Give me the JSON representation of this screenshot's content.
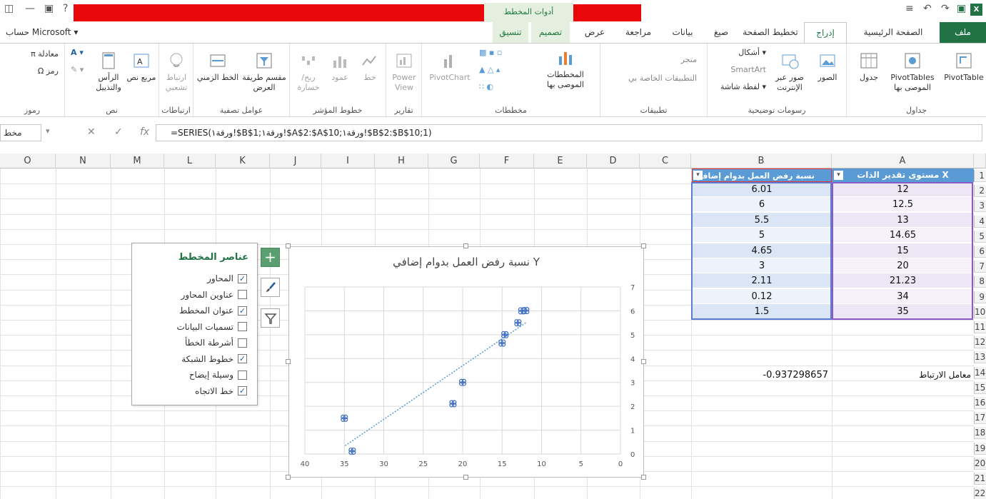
{
  "window": {
    "tools_context": "أدوات المخطط",
    "account": "حساب Microsoft ▾",
    "excel_logo": "X"
  },
  "tabs": [
    {
      "id": "file",
      "label": "ملف"
    },
    {
      "id": "home",
      "label": "الصفحة الرئيسية"
    },
    {
      "id": "insert",
      "label": "إدراج"
    },
    {
      "id": "page-layout",
      "label": "تخطيط الصفحة"
    },
    {
      "id": "formulas",
      "label": "صيغ"
    },
    {
      "id": "data",
      "label": "بيانات"
    },
    {
      "id": "review",
      "label": "مراجعة"
    },
    {
      "id": "view",
      "label": "عرض"
    },
    {
      "id": "design",
      "label": "تصميم"
    },
    {
      "id": "format",
      "label": "تنسيق"
    }
  ],
  "ribbon": {
    "tables": {
      "label": "جداول",
      "pivot_table": "PivotTable",
      "recommended_pivot": "PivotTables الموصى بها",
      "table": "جدول"
    },
    "illustrations": {
      "label": "رسومات توضيحية",
      "pictures": "الصور",
      "online_pictures": "صور عبر الإنترنت",
      "shapes": "أشكال ▾",
      "smartart": "SmartArt",
      "screenshot": "لقطة شاشة ▾"
    },
    "apps": {
      "label": "تطبيقات",
      "store": "متجر",
      "my_apps": "التطبيقات الخاصة بي"
    },
    "charts": {
      "label": "مخططات",
      "recommended": "المخططات الموصى بها",
      "pivotchart": "PivotChart"
    },
    "reports": {
      "label": "تقارير",
      "power_view": "Power View"
    },
    "sparklines": {
      "label": "خطوط المؤشر",
      "line": "خط",
      "column": "عمود",
      "win_loss": "ربح/خسارة"
    },
    "filters": {
      "label": "عوامل تصفية",
      "slicer": "مقسم طريقة العرض",
      "timeline": "الخط الزمني"
    },
    "links": {
      "label": "ارتباطات",
      "hyperlink": "ارتباط تشعبي"
    },
    "text": {
      "label": "نص",
      "textbox": "مربع نص",
      "header_footer": "الرأس والتذييل"
    },
    "symbols": {
      "label": "رموز",
      "equation": "معادلة",
      "symbol": "رمز"
    }
  },
  "formula_bar": {
    "namebox": "مخط",
    "fx": "fx",
    "formula": "=SERIES(ورقة١!$B$1;ورقة١!$A$2:$A$10;ورقة١!$B$2:$B$10;1)"
  },
  "columns": [
    "O",
    "N",
    "M",
    "L",
    "K",
    "J",
    "I",
    "H",
    "G",
    "F",
    "E",
    "D",
    "C",
    "B",
    "A"
  ],
  "rows": [
    "1",
    "2",
    "3",
    "4",
    "5",
    "6",
    "7",
    "8",
    "9",
    "10",
    "11",
    "12",
    "13",
    "14",
    "15",
    "16",
    "17",
    "18",
    "19",
    "20",
    "21",
    "22"
  ],
  "table": {
    "header_a": "مستوى تقدير الذات X",
    "header_b": "نسبة رفض العمل بدوام إضافي Y",
    "rows": [
      {
        "a": "12",
        "b": "6.01"
      },
      {
        "a": "12.5",
        "b": "6"
      },
      {
        "a": "13",
        "b": "5.5"
      },
      {
        "a": "14.65",
        "b": "5"
      },
      {
        "a": "15",
        "b": "4.65"
      },
      {
        "a": "20",
        "b": "3"
      },
      {
        "a": "21.23",
        "b": "2.11"
      },
      {
        "a": "34",
        "b": "0.12"
      },
      {
        "a": "35",
        "b": "1.5"
      }
    ],
    "corr_label": "معامل الارتباط",
    "corr_value": "-0.937298657"
  },
  "chart_elements": {
    "title": "عناصر المخطط",
    "options": [
      {
        "label": "المحاور",
        "checked": true
      },
      {
        "label": "عناوين المحاور",
        "checked": false
      },
      {
        "label": "عنوان المخطط",
        "checked": true
      },
      {
        "label": "تسميات البيانات",
        "checked": false
      },
      {
        "label": "أشرطة الخطأ",
        "checked": false
      },
      {
        "label": "خطوط الشبكة",
        "checked": true
      },
      {
        "label": "وسيلة إيضاح",
        "checked": false
      },
      {
        "label": "خط الاتجاه",
        "checked": true
      }
    ],
    "check_mark": "✓"
  },
  "colors": {
    "accent": "#217346",
    "header_a": "#5b9bd5",
    "marker": "#4472c4"
  },
  "chart_data": {
    "type": "scatter",
    "title": "نسبة رفض العمل بدوام إضافي Y",
    "x": [
      12,
      12.5,
      13,
      14.65,
      15,
      20,
      21.23,
      34,
      35
    ],
    "y": [
      6.01,
      6,
      5.5,
      5,
      4.65,
      3,
      2.11,
      0.12,
      1.5
    ],
    "xlim": [
      0,
      40
    ],
    "ylim": [
      0,
      7
    ],
    "x_reversed": true,
    "y_axis_side": "right",
    "x_ticks": [
      "40",
      "35",
      "30",
      "25",
      "20",
      "15",
      "10",
      "5",
      "0"
    ],
    "y_ticks": [
      "0",
      "1",
      "2",
      "3",
      "4",
      "5",
      "6",
      "7"
    ],
    "gridlines": true,
    "trendline": "linear-dotted",
    "legend": "none"
  }
}
